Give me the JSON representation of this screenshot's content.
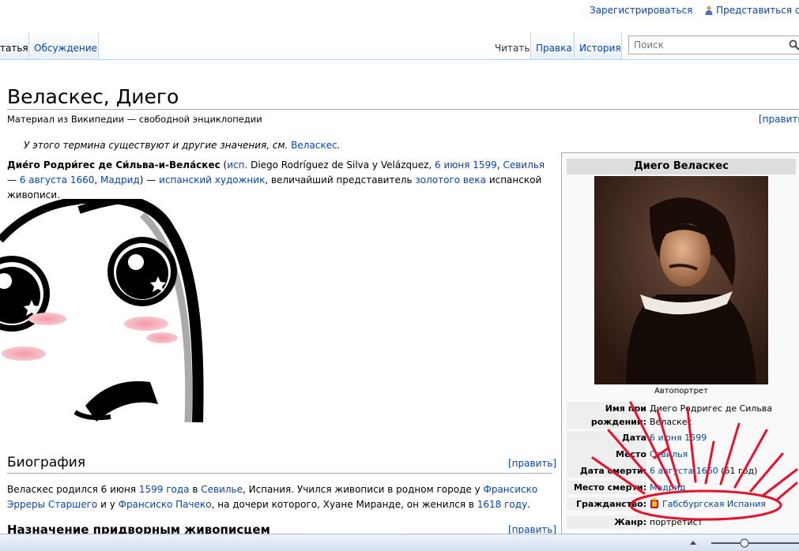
{
  "personal": {
    "register": "Зарегистрироваться",
    "login": "Представиться систем"
  },
  "tabs": {
    "article": "татья",
    "talk": "Обсуждение",
    "read": "Читать",
    "edit": "Правка",
    "history": "История"
  },
  "search": {
    "placeholder": "Поиск"
  },
  "article": {
    "title": "Веласкес, Диего",
    "site_sub": "Материал из Википедии — свободной энциклопедии",
    "edit_link": "[править]",
    "hatnote_text": "У этого термина существуют и другие значения, см. ",
    "hatnote_link": "Веласкес",
    "hatnote_end": ".",
    "intro": {
      "bold_name": "Дие́го Родри́гес де Си́льва-и-Вела́скес",
      "open_paren": " (",
      "lang_link": "исп.",
      "orig_name": " Diego Rodríguez de Silva y Velázquez, ",
      "birth_date": "6 июня 1599",
      "comma1": ", ",
      "birth_place": "Севилья",
      "dash": " — ",
      "death_date": "6 августа 1660",
      "comma2": ", ",
      "death_place": "Мадрид",
      "close_paren": ") — ",
      "occupation": "испанский художник",
      "text1": ", величайший представитель ",
      "golden_age": "золотого века",
      "text2": " испанской живописи."
    },
    "biography": {
      "heading": "Биография",
      "edit_link": "[править]",
      "t1": "Веласкес родился 6 июня ",
      "l_year": "1599 года",
      "t2": " в ",
      "l_sevilla": "Севилье",
      "t3": ", Испания. Учился живописи в родном городе у ",
      "l_herrera": "Франсиско Эрреры Старшего",
      "t4": " и у ",
      "l_pacheco": "Франсиско Пачеко",
      "t5": ", на дочери которого, Хуане Миранде, он женился в ",
      "l_1618": "1618 году",
      "t6": "."
    },
    "next_heading": "Назначение придворным живописцем",
    "next_edit": "[править]"
  },
  "infobox": {
    "title": "Диего Веласкес",
    "caption": "Автопортрет",
    "rows": [
      {
        "label": "Имя при рождении:",
        "value": "Диего Родригес де Сильва Веласкес"
      },
      {
        "label": "Дата рождения:",
        "value": "6 июня 1599"
      },
      {
        "label": "Место рождения:",
        "value": "Севилья"
      },
      {
        "label": "Дата смерти:",
        "value": "6 августа 1660",
        "extra": " (61 год)"
      },
      {
        "label": "Место смерти:",
        "value": "Мадрид"
      },
      {
        "label": "Гражданство:",
        "value": "Габсбургская Испания"
      },
      {
        "label": "Жанр:",
        "value": "портретист"
      }
    ]
  },
  "colors": {
    "link": "#0645ad",
    "annotation": "#e8112d"
  }
}
